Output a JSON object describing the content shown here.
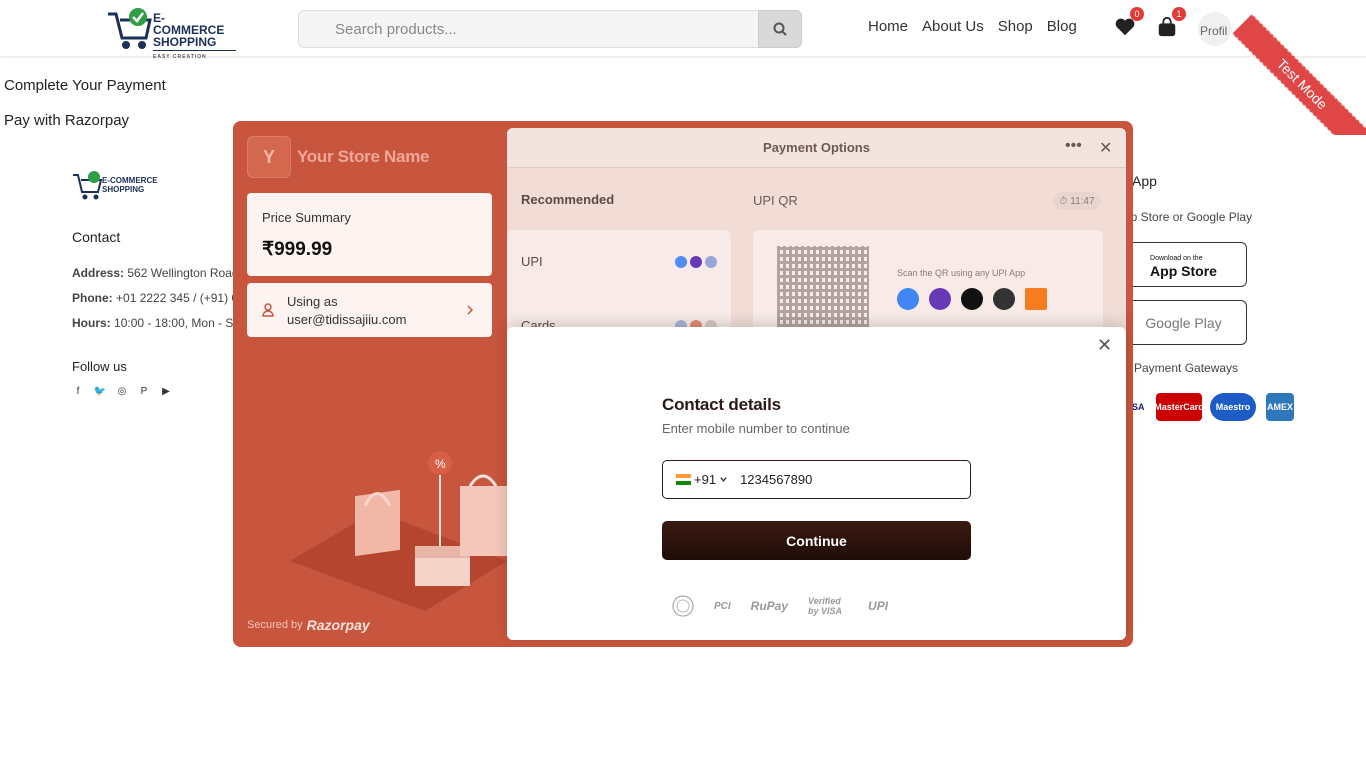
{
  "header": {
    "logo_title": "E-COMMERCE",
    "logo_title2": "SHOPPING",
    "logo_tag": "EASY CREATION",
    "search_placeholder": "Search products...",
    "nav": [
      "Home",
      "About Us",
      "Shop",
      "Blog"
    ],
    "wishlist_count": "0",
    "cart_count": "1",
    "profile_alt": "Profil",
    "test_mode": "Test Mode"
  },
  "page": {
    "heading": "Complete Your Payment",
    "subheading": "Pay with Razorpay"
  },
  "footer": {
    "contact_heading": "Contact",
    "address_label": "Address:",
    "address_value": "562 Wellington Road",
    "phone_label": "Phone:",
    "phone_value": "+01 2222 345 / (+91) 0",
    "hours_label": "Hours:",
    "hours_value": "10:00 - 18:00, Mon - Sa",
    "follow_heading": "Follow us",
    "app_heading": "App",
    "app_sub": "op Store or Google Play",
    "app_store_small": "Download on the",
    "app_store": "App Store",
    "google_play": "Google Play",
    "gateways": "d Payment Gateways",
    "cards": [
      "VISA",
      "MasterCard",
      "Maestro",
      "AMEX"
    ]
  },
  "razorpay": {
    "store_initial": "Y",
    "store_name": "Your Store Name",
    "price_label": "Price Summary",
    "price_value": "₹999.99",
    "using_as": "Using as",
    "user_email": "user@tidissajiiu.com",
    "secured_by": "Secured by",
    "brand": "Razorpay",
    "options_title": "Payment Options",
    "recommended": "Recommended",
    "upi_qr": "UPI QR",
    "timer": "11:47",
    "methods": [
      "UPI",
      "Cards"
    ],
    "qr_hint": "Scan the QR using any UPI App"
  },
  "contact": {
    "title": "Contact details",
    "subtitle": "Enter mobile number to continue",
    "country_code": "+91",
    "phone_value": "1234567890",
    "continue_label": "Continue",
    "trust_badges": [
      "RuPay",
      "Verified by VISA",
      "UPI"
    ],
    "pci": "PCI"
  },
  "colors": {
    "razorpay_bg": "#c8553d",
    "button_dark": "#2a1209",
    "badge_red": "#e53935",
    "ribbon_red": "#e04646"
  }
}
